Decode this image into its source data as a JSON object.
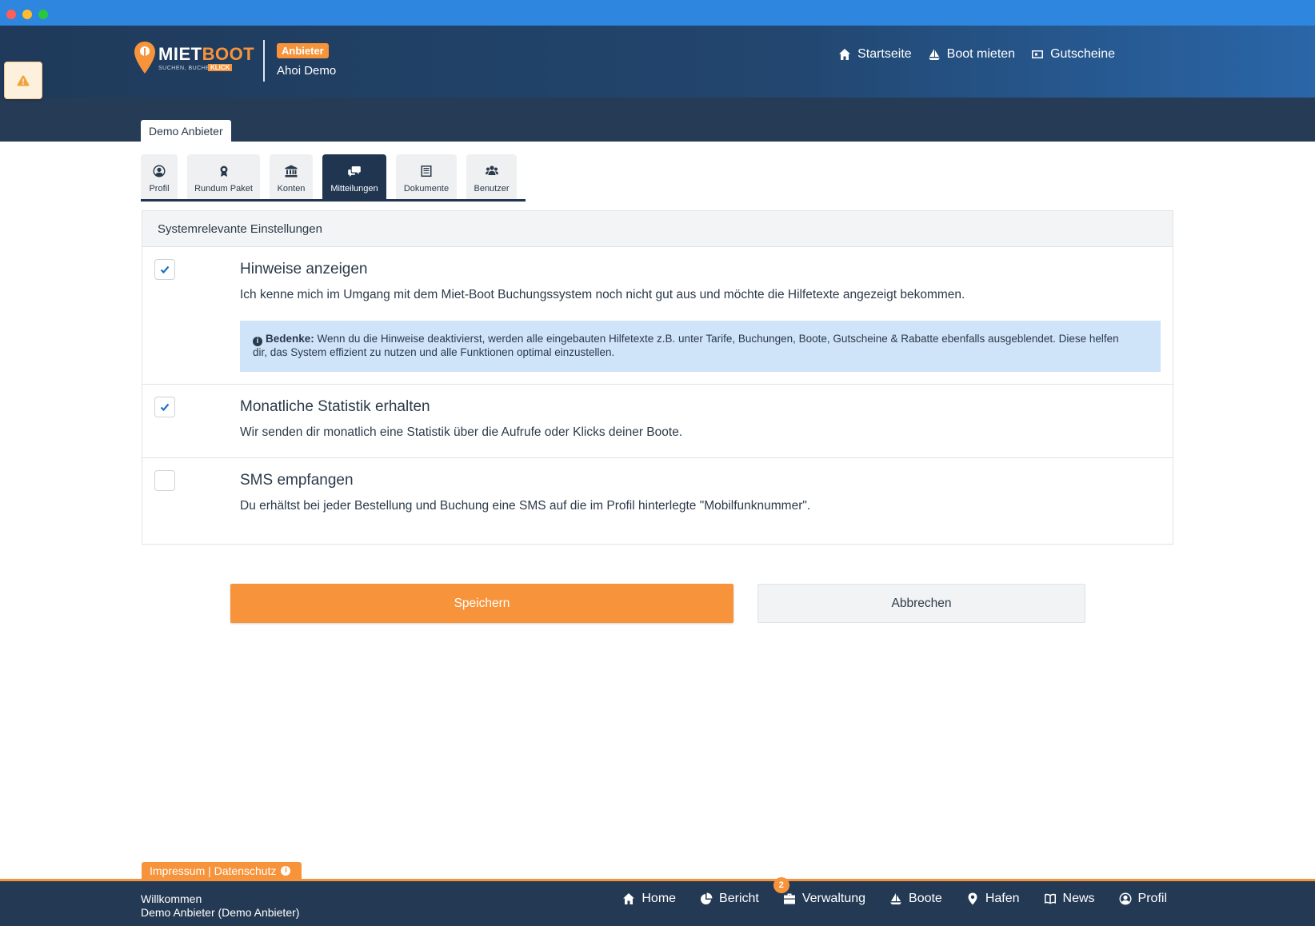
{
  "header": {
    "logo": {
      "word_main": "MIET",
      "word_accent": "BOOT",
      "tagline": "SUCHEN, BUCHEN",
      "klick": "KLICK"
    },
    "role_badge": "Anbieter",
    "user_name": "Ahoi Demo",
    "nav": [
      {
        "label": "Startseite",
        "icon": "home-icon"
      },
      {
        "label": "Boot mieten",
        "icon": "sailboat-icon"
      },
      {
        "label": "Gutscheine",
        "icon": "voucher-icon"
      }
    ]
  },
  "provider_tab": "Demo Anbieter",
  "tabs": [
    {
      "label": "Profil",
      "icon": "user-circle-icon"
    },
    {
      "label": "Rundum Paket",
      "icon": "award-icon"
    },
    {
      "label": "Konten",
      "icon": "bank-icon"
    },
    {
      "label": "Mitteilungen",
      "icon": "chat-icon",
      "active": true
    },
    {
      "label": "Dokumente",
      "icon": "document-icon"
    },
    {
      "label": "Benutzer",
      "icon": "users-icon"
    }
  ],
  "panel": {
    "title": "Systemrelevante Einstellungen",
    "settings": [
      {
        "title": "Hinweise anzeigen",
        "description": "Ich kenne mich im Umgang mit dem Miet-Boot Buchungssystem noch nicht gut aus und möchte die Hilfetexte angezeigt bekommen.",
        "checked": true,
        "note_label": "Bedenke:",
        "note_line1": "Wenn du die Hinweise deaktivierst, werden alle eingebauten Hilfetexte z.B. unter Tarife, Buchungen, Boote, Gutscheine & Rabatte ebenfalls ausgeblendet. Diese helfen",
        "note_line2": "dir, das System effizient zu nutzen und alle Funktionen optimal einzustellen."
      },
      {
        "title": "Monatliche Statistik erhalten",
        "description": "Wir senden dir monatlich eine Statistik über die Aufrufe oder Klicks deiner Boote.",
        "checked": true
      },
      {
        "title": "SMS empfangen",
        "description": "Du erhältst bei jeder Bestellung und Buchung eine SMS auf die im Profil hinterlegte \"Mobilfunknummer\".",
        "checked": false
      }
    ]
  },
  "buttons": {
    "save": "Speichern",
    "cancel": "Abbrechen"
  },
  "footer": {
    "legal": "Impressum | Datenschutz",
    "welcome": "Willkommen",
    "account": "Demo Anbieter (Demo Anbieter)",
    "nav": [
      {
        "label": "Home",
        "icon": "home-icon"
      },
      {
        "label": "Bericht",
        "icon": "pie-chart-icon"
      },
      {
        "label": "Verwaltung",
        "icon": "briefcase-icon",
        "badge": "2"
      },
      {
        "label": "Boote",
        "icon": "sailboat-icon"
      },
      {
        "label": "Hafen",
        "icon": "map-pin-icon"
      },
      {
        "label": "News",
        "icon": "newspaper-icon"
      },
      {
        "label": "Profil",
        "icon": "user-circle-icon"
      }
    ]
  },
  "colors": {
    "accent": "#f7943b",
    "navy": "#1f3550",
    "info_bg": "#cfe3f9",
    "check": "#1e6fc4"
  }
}
